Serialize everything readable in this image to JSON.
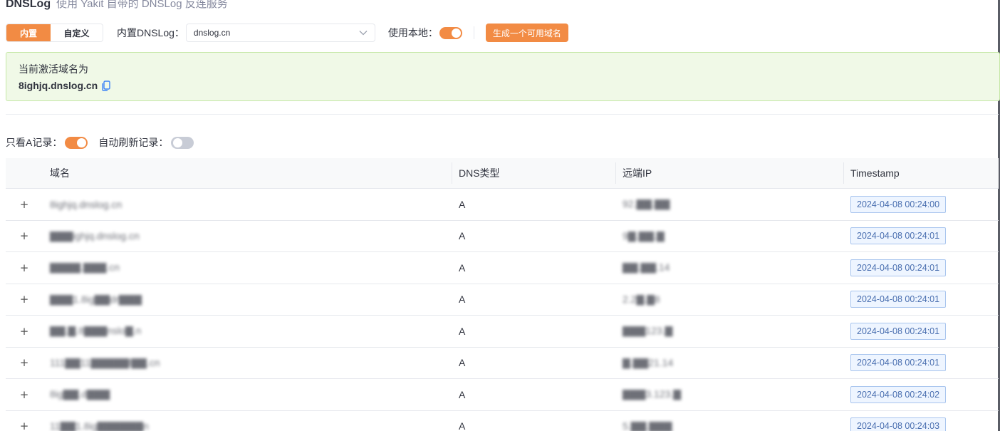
{
  "header": {
    "title": "DNSLog",
    "subtitle": "使用 Yakit 自带的 DNSLog 反连服务"
  },
  "toolbar": {
    "mode_tabs": [
      {
        "label": "内置",
        "active": true
      },
      {
        "label": "自定义",
        "active": false
      }
    ],
    "builtin_label": "内置DNSLog：",
    "builtin_value": "dnslog.cn",
    "use_local_label": "使用本地：",
    "use_local_on": true,
    "generate_label": "生成一个可用域名"
  },
  "alert": {
    "title": "当前激活域名为",
    "domain": "8ighjq.dnslog.cn"
  },
  "filters": {
    "only_a_label": "只看A记录：",
    "only_a_on": true,
    "auto_refresh_label": "自动刷新记录：",
    "auto_refresh_on": false
  },
  "table": {
    "columns": [
      "域名",
      "DNS类型",
      "远端IP",
      "Timestamp"
    ],
    "rows": [
      {
        "domain": "8ighjq.dnslog.cn",
        "type": "A",
        "ip": "92.▇▇.▇▇",
        "timestamp": "2024-04-08 00:24:00"
      },
      {
        "domain": "▇▇▇ighjq.dnslog.cn",
        "type": "A",
        "ip": "9▇.▇▇.▇",
        "timestamp": "2024-04-08 00:24:01"
      },
      {
        "domain": "▇▇▇▇.▇▇▇.cn",
        "type": "A",
        "ip": "▇▇.▇▇.14",
        "timestamp": "2024-04-08 00:24:01"
      },
      {
        "domain": "▇▇▇1.8ig▇▇dr▇▇▇",
        "type": "A",
        "ip": "2.2▇.▇8",
        "timestamp": "2024-04-08 00:24:01"
      },
      {
        "domain": "▇▇.▇.8▇▇▇nslo▇.n",
        "type": "A",
        "ip": "▇▇▇123.▇",
        "timestamp": "2024-04-08 00:24:01"
      },
      {
        "domain": "111▇▇11▇▇▇▇▇l▇▇.cn",
        "type": "A",
        "ip": "▇.▇▇21.14",
        "timestamp": "2024-04-08 00:24:01"
      },
      {
        "domain": "8ig▇▇.d▇▇▇",
        "type": "A",
        "ip": "▇▇▇3.123.▇",
        "timestamp": "2024-04-08 00:24:02"
      },
      {
        "domain": "11▇▇1.8ig▇▇▇▇▇▇n",
        "type": "A",
        "ip": "5.▇▇.▇▇▇",
        "timestamp": "2024-04-08 00:24:03"
      }
    ]
  },
  "colors": {
    "accent": "#f28b44",
    "alert_bg": "#f0f9e7",
    "alert_border": "#c5e8a6",
    "tag_blue": "#4a6fb0"
  }
}
